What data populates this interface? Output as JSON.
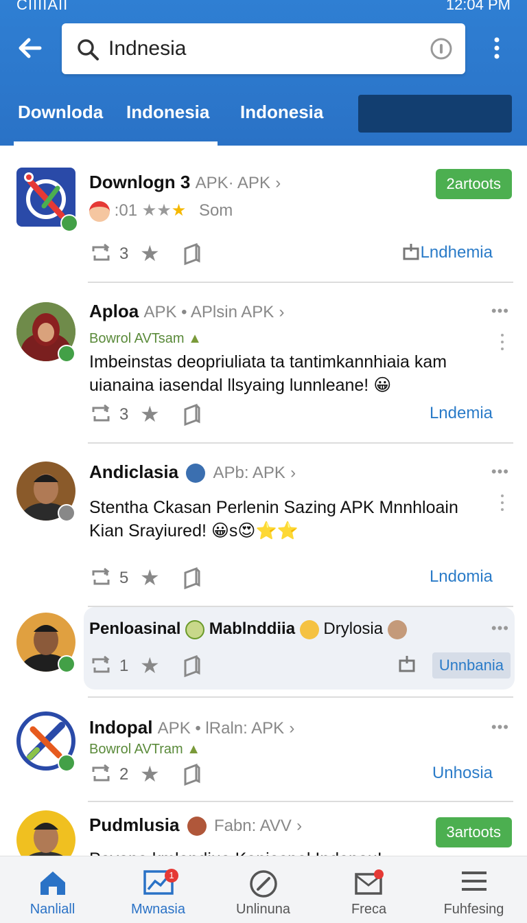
{
  "status_bar": {
    "carrier": "CIIIIAII",
    "time": "12:04 PM"
  },
  "search": {
    "value": "Indnesia"
  },
  "tabs": [
    {
      "label": "Downloda"
    },
    {
      "label": "Indonesia"
    },
    {
      "label": "Indonesia"
    }
  ],
  "posts": [
    {
      "name": "Downlogn 3",
      "meta": "APK· APK",
      "badge": "2artoots",
      "rating_text": ":01",
      "rating_suffix": "Som",
      "repost_count": "3",
      "link": "Lndhemia"
    },
    {
      "name": "Aploa",
      "meta": "APK • APlsin APK",
      "sub": "Bowrol AVTsam",
      "text": "Imbeinstas deopriuliata ta tantimkannhiaia kam uianaina iasendal llsyaing lunnleane! 😀",
      "repost_count": "3",
      "link": "Lndemia"
    },
    {
      "name": "Andiclasia",
      "meta": "APb: APK",
      "text": "Stentha Ckasan Perlenin Sazing APK Mnnhloain Kian Srayiured! 😀s😍⭐⭐",
      "repost_count": "5",
      "link": "Lndomia"
    },
    {
      "name": "Penloasinal",
      "name2": "Mablnddiia",
      "name3": "Drylosia",
      "repost_count": "1",
      "link": "Unnbania"
    },
    {
      "name": "Indopal",
      "meta": "APK • lRaln: APK",
      "sub": "Bowrol AVTram",
      "repost_count": "2",
      "link": "Unhosia"
    },
    {
      "name": "Pudmlusia",
      "meta": "Fabn: AVV",
      "badge": "3artoots",
      "text": "Pavona kmlendiua Kaniesnal Indanou!"
    }
  ],
  "bottom_nav": [
    {
      "label": "Nanliall",
      "icon": "home-icon"
    },
    {
      "label": "Mwnasia",
      "icon": "chart-icon",
      "badge": "1"
    },
    {
      "label": "Unlinuna",
      "icon": "compass-icon"
    },
    {
      "label": "Freca",
      "icon": "mail-icon"
    },
    {
      "label": "Fuhfesing",
      "icon": "menu-icon"
    }
  ],
  "colors": {
    "primary": "#2f7fd3",
    "accent": "#2a7bc8",
    "badge_green": "#4caf50",
    "tab_dark": "#123e70"
  }
}
